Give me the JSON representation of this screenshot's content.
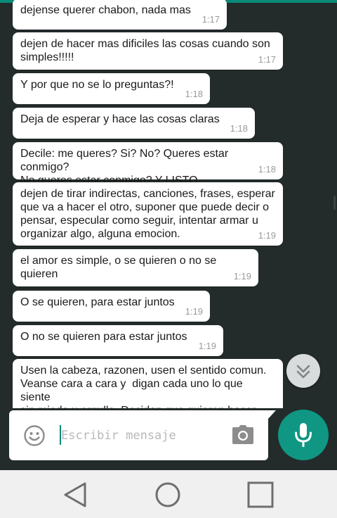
{
  "colors": {
    "chat_background": "#232b2b",
    "bubble": "#ffffff",
    "accent": "#0f9783",
    "timestamp": "#9a9a9a"
  },
  "messages": [
    {
      "text": "dejense querer chabon, nada mas",
      "time": "1:17"
    },
    {
      "text": "dejen de hacer mas dificiles las cosas cuando son\nsimples!!!!!",
      "time": "1:17"
    },
    {
      "text": "Y por que no se lo preguntas?!",
      "time": "1:18"
    },
    {
      "text": "Deja de esperar y hace las cosas claras",
      "time": "1:18"
    },
    {
      "text": "Decile: me queres? Si? No? Queres estar conmigo?\nNo queres estar conmigo? Y LISTO",
      "time": "1:18"
    },
    {
      "text": "dejen de tirar indirectas, canciones, frases, esperar\nque va a hacer el otro, suponer que puede decir o\npensar, especular como seguir, intentar armar u\norganizar algo, alguna emocion.",
      "time": "1:19"
    },
    {
      "text": "el amor es simple, o se quieren o no se quieren",
      "time": "1:19"
    },
    {
      "text": "O se quieren, para estar juntos",
      "time": "1:19"
    },
    {
      "text": "O no se quieren para estar juntos",
      "time": "1:19"
    },
    {
      "text": "Usen la cabeza, razonen, usen el sentido comun.\nVeanse cara a cara y  digan cada uno lo que siente\nsin miedo u orgullo. Decidan que quieren hacer",
      "time": ""
    }
  ],
  "composer": {
    "placeholder": "Escribir mensaje",
    "emoji_icon": "emoji-icon",
    "camera_icon": "camera-icon",
    "mic_icon": "microphone-icon"
  },
  "icons": {
    "scroll_down": "double-chevron-down-icon",
    "nav_back": "back-triangle-icon",
    "nav_home": "home-circle-icon",
    "nav_recent": "recent-apps-square-icon"
  }
}
